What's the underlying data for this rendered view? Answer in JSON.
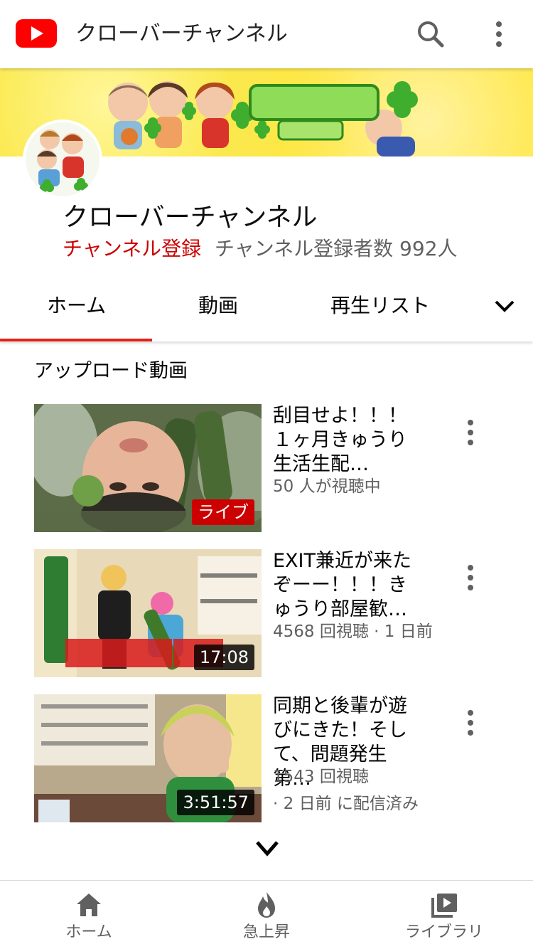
{
  "appbar": {
    "title": "クローバーチャンネル"
  },
  "channel": {
    "name": "クローバーチャンネル",
    "subscribe_label": "チャンネル登録",
    "subscriber_count": "チャンネル登録者数 992人"
  },
  "tabs": [
    {
      "label": "ホーム",
      "active": true
    },
    {
      "label": "動画",
      "active": false
    },
    {
      "label": "再生リスト",
      "active": false
    }
  ],
  "section": {
    "title": "アップロード動画"
  },
  "videos": [
    {
      "title": "刮目せよ！！！\n１ヶ月きゅうり\n生活生配…",
      "meta": "50 人が視聴中",
      "meta2": "",
      "badge": "ライブ",
      "live": true
    },
    {
      "title": "EXIT兼近が来た\nぞーー！！！き\nゅうり部屋歓…",
      "meta": "4568 回視聴 · 1 日前",
      "meta2": "",
      "badge": "17:08",
      "live": false
    },
    {
      "title": "同期と後輩が遊\nびにきた！そし\nて、問題発生第…",
      "meta": "1543 回視聴",
      "meta2": "· 2 日前 に配信済み",
      "badge": "3:51:57",
      "live": false
    }
  ],
  "bottom_nav": [
    {
      "label": "ホーム",
      "icon": "home-icon"
    },
    {
      "label": "急上昇",
      "icon": "trending-icon"
    },
    {
      "label": "ライブラリ",
      "icon": "library-icon"
    }
  ],
  "colors": {
    "brand_red": "#ff0000",
    "subscribe_red": "#cc0000",
    "tab_indicator": "#e62117",
    "secondary_text": "#606060"
  }
}
